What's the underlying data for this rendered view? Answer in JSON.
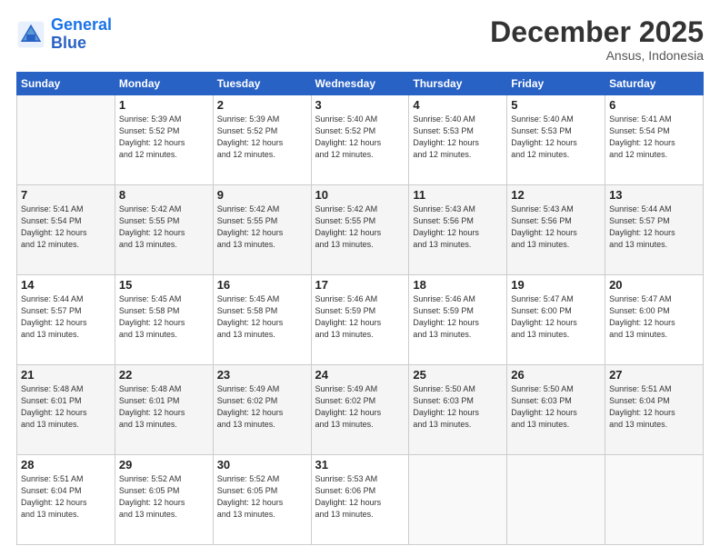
{
  "logo": {
    "line1": "General",
    "line2": "Blue"
  },
  "title": "December 2025",
  "subtitle": "Ansus, Indonesia",
  "days_header": [
    "Sunday",
    "Monday",
    "Tuesday",
    "Wednesday",
    "Thursday",
    "Friday",
    "Saturday"
  ],
  "weeks": [
    [
      {
        "day": "",
        "info": ""
      },
      {
        "day": "1",
        "info": "Sunrise: 5:39 AM\nSunset: 5:52 PM\nDaylight: 12 hours\nand 12 minutes."
      },
      {
        "day": "2",
        "info": "Sunrise: 5:39 AM\nSunset: 5:52 PM\nDaylight: 12 hours\nand 12 minutes."
      },
      {
        "day": "3",
        "info": "Sunrise: 5:40 AM\nSunset: 5:52 PM\nDaylight: 12 hours\nand 12 minutes."
      },
      {
        "day": "4",
        "info": "Sunrise: 5:40 AM\nSunset: 5:53 PM\nDaylight: 12 hours\nand 12 minutes."
      },
      {
        "day": "5",
        "info": "Sunrise: 5:40 AM\nSunset: 5:53 PM\nDaylight: 12 hours\nand 12 minutes."
      },
      {
        "day": "6",
        "info": "Sunrise: 5:41 AM\nSunset: 5:54 PM\nDaylight: 12 hours\nand 12 minutes."
      }
    ],
    [
      {
        "day": "7",
        "info": "Sunrise: 5:41 AM\nSunset: 5:54 PM\nDaylight: 12 hours\nand 12 minutes."
      },
      {
        "day": "8",
        "info": "Sunrise: 5:42 AM\nSunset: 5:55 PM\nDaylight: 12 hours\nand 13 minutes."
      },
      {
        "day": "9",
        "info": "Sunrise: 5:42 AM\nSunset: 5:55 PM\nDaylight: 12 hours\nand 13 minutes."
      },
      {
        "day": "10",
        "info": "Sunrise: 5:42 AM\nSunset: 5:55 PM\nDaylight: 12 hours\nand 13 minutes."
      },
      {
        "day": "11",
        "info": "Sunrise: 5:43 AM\nSunset: 5:56 PM\nDaylight: 12 hours\nand 13 minutes."
      },
      {
        "day": "12",
        "info": "Sunrise: 5:43 AM\nSunset: 5:56 PM\nDaylight: 12 hours\nand 13 minutes."
      },
      {
        "day": "13",
        "info": "Sunrise: 5:44 AM\nSunset: 5:57 PM\nDaylight: 12 hours\nand 13 minutes."
      }
    ],
    [
      {
        "day": "14",
        "info": "Sunrise: 5:44 AM\nSunset: 5:57 PM\nDaylight: 12 hours\nand 13 minutes."
      },
      {
        "day": "15",
        "info": "Sunrise: 5:45 AM\nSunset: 5:58 PM\nDaylight: 12 hours\nand 13 minutes."
      },
      {
        "day": "16",
        "info": "Sunrise: 5:45 AM\nSunset: 5:58 PM\nDaylight: 12 hours\nand 13 minutes."
      },
      {
        "day": "17",
        "info": "Sunrise: 5:46 AM\nSunset: 5:59 PM\nDaylight: 12 hours\nand 13 minutes."
      },
      {
        "day": "18",
        "info": "Sunrise: 5:46 AM\nSunset: 5:59 PM\nDaylight: 12 hours\nand 13 minutes."
      },
      {
        "day": "19",
        "info": "Sunrise: 5:47 AM\nSunset: 6:00 PM\nDaylight: 12 hours\nand 13 minutes."
      },
      {
        "day": "20",
        "info": "Sunrise: 5:47 AM\nSunset: 6:00 PM\nDaylight: 12 hours\nand 13 minutes."
      }
    ],
    [
      {
        "day": "21",
        "info": "Sunrise: 5:48 AM\nSunset: 6:01 PM\nDaylight: 12 hours\nand 13 minutes."
      },
      {
        "day": "22",
        "info": "Sunrise: 5:48 AM\nSunset: 6:01 PM\nDaylight: 12 hours\nand 13 minutes."
      },
      {
        "day": "23",
        "info": "Sunrise: 5:49 AM\nSunset: 6:02 PM\nDaylight: 12 hours\nand 13 minutes."
      },
      {
        "day": "24",
        "info": "Sunrise: 5:49 AM\nSunset: 6:02 PM\nDaylight: 12 hours\nand 13 minutes."
      },
      {
        "day": "25",
        "info": "Sunrise: 5:50 AM\nSunset: 6:03 PM\nDaylight: 12 hours\nand 13 minutes."
      },
      {
        "day": "26",
        "info": "Sunrise: 5:50 AM\nSunset: 6:03 PM\nDaylight: 12 hours\nand 13 minutes."
      },
      {
        "day": "27",
        "info": "Sunrise: 5:51 AM\nSunset: 6:04 PM\nDaylight: 12 hours\nand 13 minutes."
      }
    ],
    [
      {
        "day": "28",
        "info": "Sunrise: 5:51 AM\nSunset: 6:04 PM\nDaylight: 12 hours\nand 13 minutes."
      },
      {
        "day": "29",
        "info": "Sunrise: 5:52 AM\nSunset: 6:05 PM\nDaylight: 12 hours\nand 13 minutes."
      },
      {
        "day": "30",
        "info": "Sunrise: 5:52 AM\nSunset: 6:05 PM\nDaylight: 12 hours\nand 13 minutes."
      },
      {
        "day": "31",
        "info": "Sunrise: 5:53 AM\nSunset: 6:06 PM\nDaylight: 12 hours\nand 13 minutes."
      },
      {
        "day": "",
        "info": ""
      },
      {
        "day": "",
        "info": ""
      },
      {
        "day": "",
        "info": ""
      }
    ]
  ]
}
